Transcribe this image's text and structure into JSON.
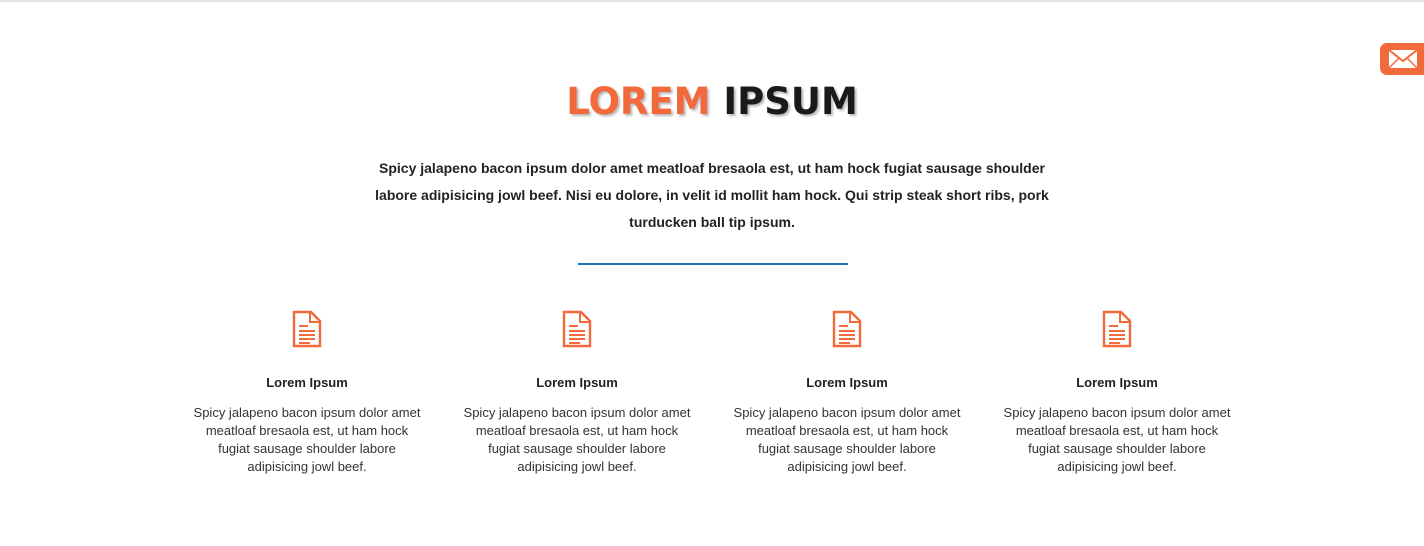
{
  "header": {
    "title_accent": "LOREM",
    "title_dark": "IPSUM",
    "intro": "Spicy jalapeno bacon ipsum dolor amet meatloaf bresaola est, ut ham hock fugiat sausage shoulder labore adipisicing jowl beef. Nisi eu dolore, in velit id mollit ham hock. Qui strip steak short ribs, pork turducken ball tip ipsum."
  },
  "contact_tab": {
    "icon": "envelope-icon"
  },
  "features": [
    {
      "icon": "document-icon",
      "title": "Lorem Ipsum",
      "text": "Spicy jalapeno bacon ipsum dolor amet meatloaf bresaola est, ut ham hock fugiat sausage shoulder labore adipisicing jowl beef."
    },
    {
      "icon": "document-icon",
      "title": "Lorem Ipsum",
      "text": "Spicy jalapeno bacon ipsum dolor amet meatloaf bresaola est, ut ham hock fugiat sausage shoulder labore adipisicing jowl beef."
    },
    {
      "icon": "document-icon",
      "title": "Lorem Ipsum",
      "text": "Spicy jalapeno bacon ipsum dolor amet meatloaf bresaola est, ut ham hock fugiat sausage shoulder labore adipisicing jowl beef."
    },
    {
      "icon": "document-icon",
      "title": "Lorem Ipsum",
      "text": "Spicy jalapeno bacon ipsum dolor amet meatloaf bresaola est, ut ham hock fugiat sausage shoulder labore adipisicing jowl beef."
    }
  ],
  "colors": {
    "accent": "#f26a3b",
    "divider": "#1d6fb8",
    "heading_dark": "#1a1a1a"
  }
}
